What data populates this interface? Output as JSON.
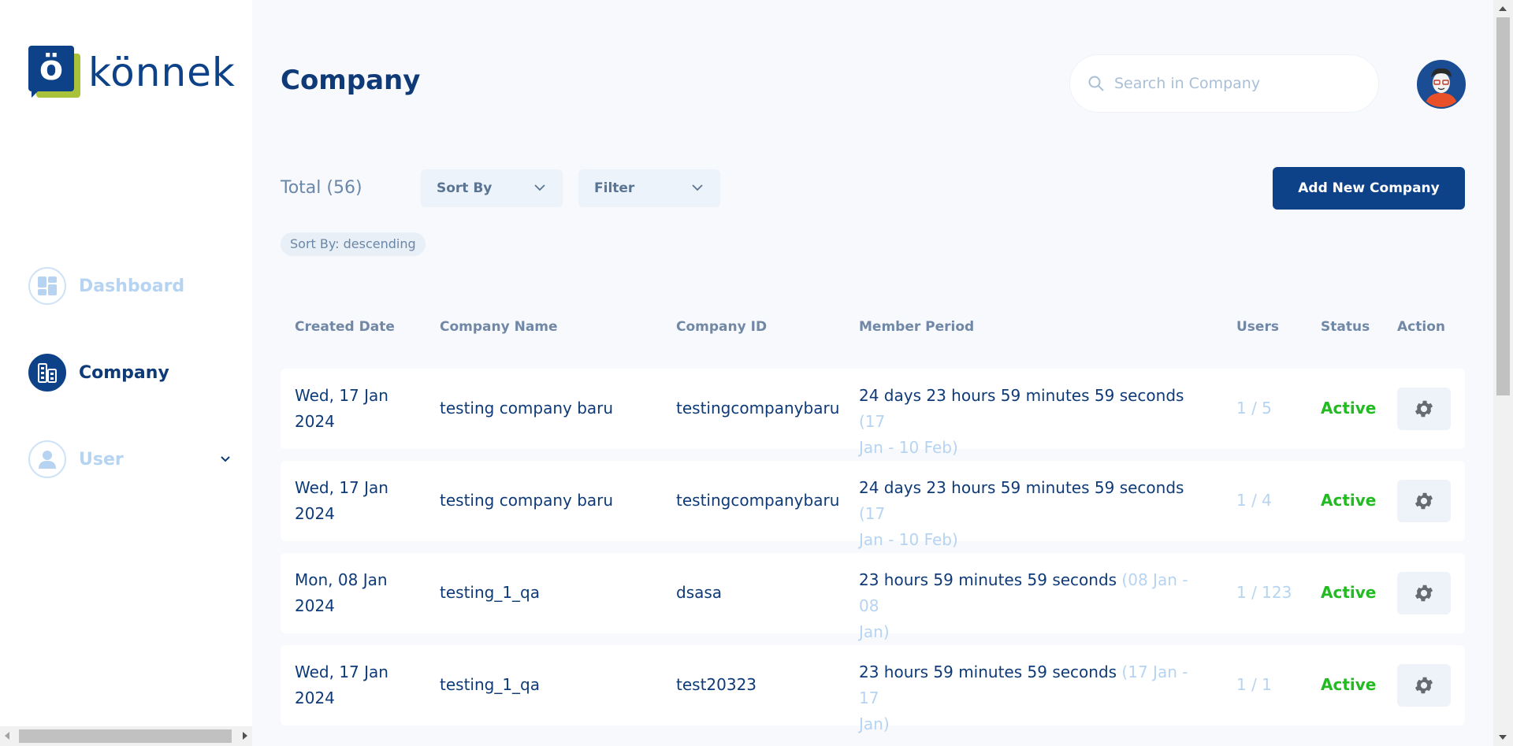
{
  "brand": {
    "logo_letter": "ö",
    "name": "könnek"
  },
  "sidebar": {
    "items": [
      {
        "label": "Dashboard",
        "icon": "dashboard-icon",
        "active": false
      },
      {
        "label": "Company",
        "icon": "company-icon",
        "active": true
      },
      {
        "label": "User",
        "icon": "user-icon",
        "active": false,
        "expandable": true
      }
    ]
  },
  "header": {
    "title": "Company"
  },
  "search": {
    "placeholder": "Search in Company",
    "value": ""
  },
  "toolbar": {
    "total": "Total (56)",
    "sort_label": "Sort By",
    "filter_label": "Filter",
    "add_label": "Add New Company",
    "sort_chip": "Sort By: descending"
  },
  "table": {
    "columns": [
      "Created Date",
      "Company Name",
      "Company ID",
      "Member Period",
      "Users",
      "Status",
      "Action"
    ],
    "rows": [
      {
        "date_line1": "Wed, 17 Jan",
        "date_line2": "2024",
        "name": "testing company baru",
        "id": "testingcompanybaru",
        "period_main": "24 days 23 hours 59 minutes 59 seconds",
        "period_range_a": " (17",
        "period_range_b": "Jan - 10 Feb)",
        "users": "1 / 5",
        "status": "Active"
      },
      {
        "date_line1": "Wed, 17 Jan",
        "date_line2": "2024",
        "name": "testing company baru",
        "id": "testingcompanybaru",
        "period_main": "24 days 23 hours 59 minutes 59 seconds",
        "period_range_a": " (17",
        "period_range_b": "Jan - 10 Feb)",
        "users": "1 / 4",
        "status": "Active"
      },
      {
        "date_line1": "Mon, 08 Jan",
        "date_line2": "2024",
        "name": "testing_1_qa",
        "id": "dsasa",
        "period_main": "23 hours 59 minutes 59 seconds",
        "period_range_a": " (08 Jan - 08",
        "period_range_b": "Jan)",
        "users": "1 / 123",
        "status": "Active"
      },
      {
        "date_line1": "Wed, 17 Jan",
        "date_line2": "2024",
        "name": "testing_1_qa",
        "id": "test20323",
        "period_main": "23 hours 59 minutes 59 seconds",
        "period_range_a": " (17 Jan - 17",
        "period_range_b": "Jan)",
        "users": "1 / 1",
        "status": "Active"
      }
    ]
  },
  "colors": {
    "primary": "#0e4288",
    "accent": "#a8c33a",
    "active_status": "#22bb22",
    "muted": "#b6d4f2"
  }
}
